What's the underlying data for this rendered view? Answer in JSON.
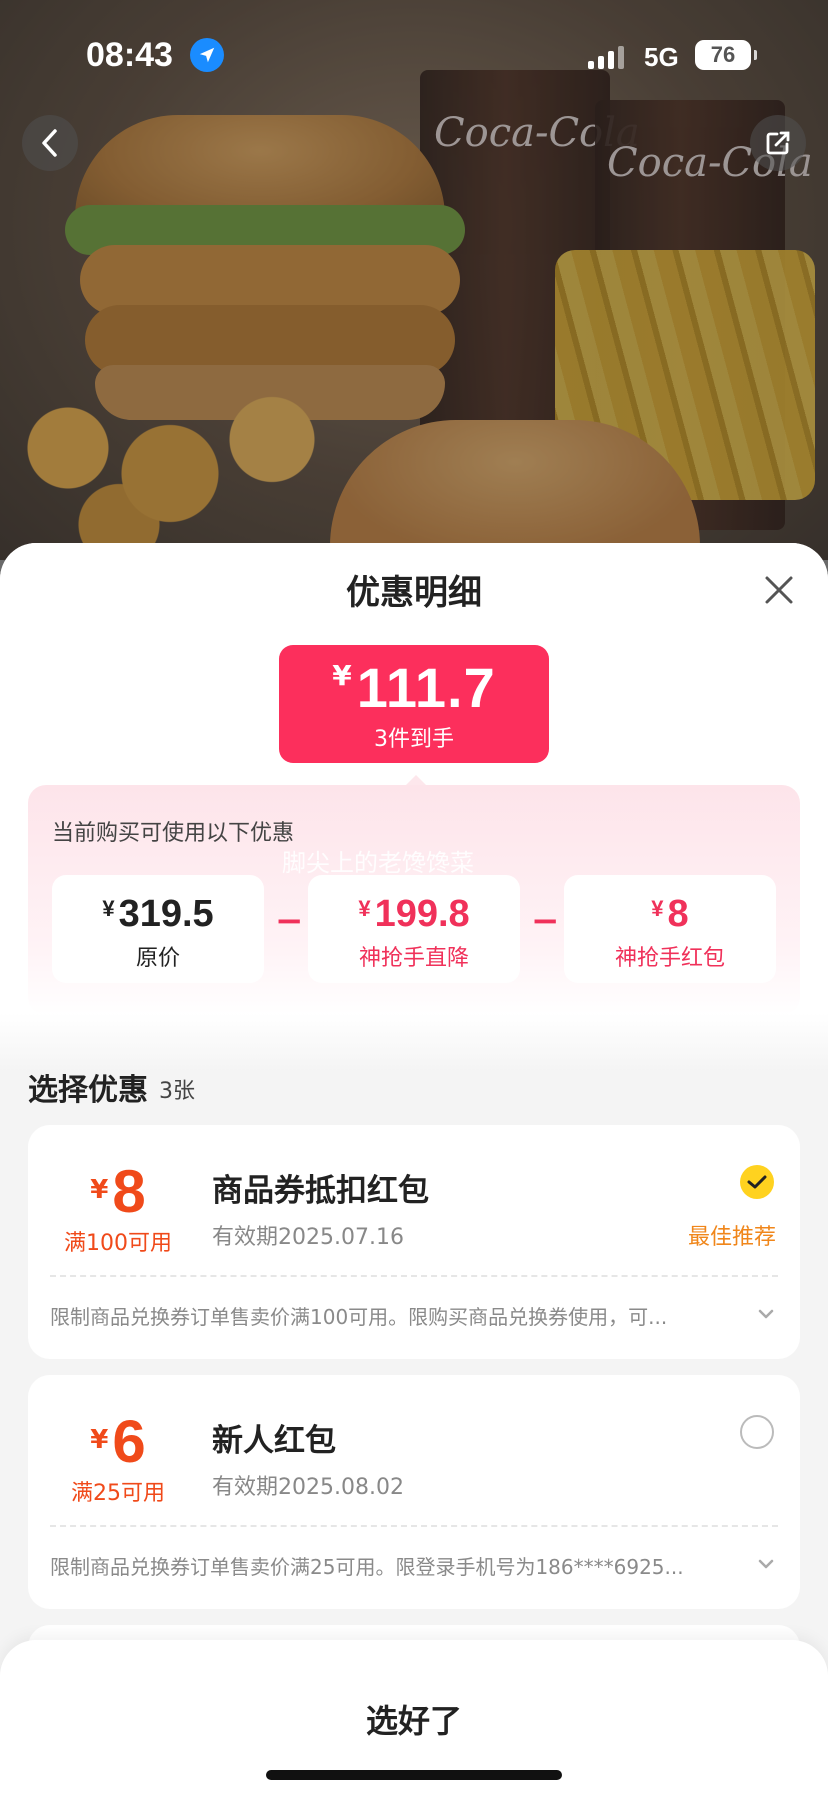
{
  "status_bar": {
    "time": "08:43",
    "network": "5G",
    "battery": "76"
  },
  "sheet": {
    "title": "优惠明细",
    "final_price": {
      "currency": "¥",
      "amount": "111.7",
      "subtitle": "3件到手"
    },
    "breakdown": {
      "hint": "当前购买可使用以下优惠",
      "watermark": "脚尖上的老馋馋菜",
      "items": [
        {
          "currency": "¥",
          "value": "319.5",
          "label": "原价"
        },
        {
          "currency": "¥",
          "value": "199.8",
          "label": "神抢手直降"
        },
        {
          "currency": "¥",
          "value": "8",
          "label": "神抢手红包"
        }
      ],
      "operator": "−"
    },
    "select_section": {
      "title": "选择优惠",
      "count": "3张"
    },
    "coupons": [
      {
        "currency": "¥",
        "amount": "8",
        "condition": "满100可用",
        "title": "商品券抵扣红包",
        "validity": "有效期2025.07.16",
        "badge": "最佳推荐",
        "selected": true,
        "description": "限制商品兑换券订单售卖价满100可用。限购买商品兑换券使用，可..."
      },
      {
        "currency": "¥",
        "amount": "6",
        "condition": "满25可用",
        "title": "新人红包",
        "validity": "有效期2025.08.02",
        "badge": "",
        "selected": false,
        "description": "限制商品兑换券订单售卖价满25可用。限登录手机号为186****6925..."
      }
    ],
    "footer": {
      "confirm_label": "选好了"
    }
  },
  "colors": {
    "price_red": "#fc2f5c",
    "coupon_orange": "#f04a1a",
    "badge_orange": "#f0861a",
    "check_yellow": "#ffd21f"
  }
}
